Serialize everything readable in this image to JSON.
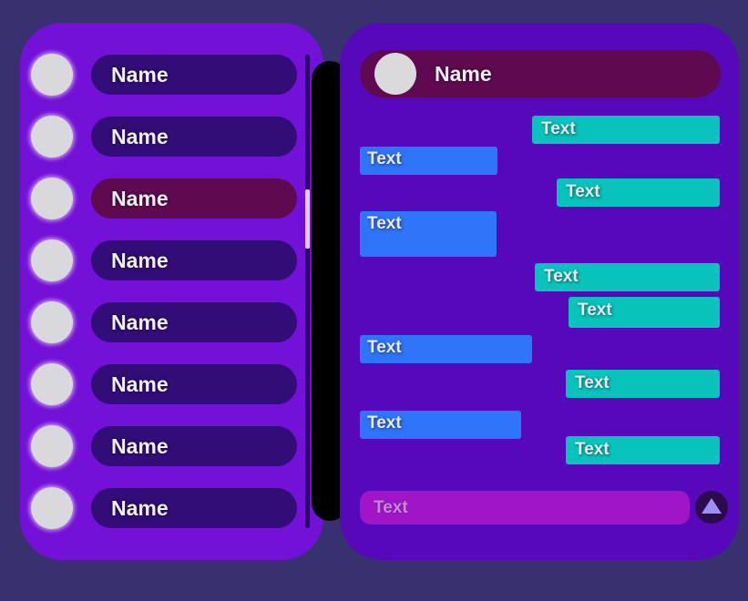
{
  "contacts": [
    {
      "name": "Name",
      "active": false
    },
    {
      "name": "Name",
      "active": false
    },
    {
      "name": "Name",
      "active": true
    },
    {
      "name": "Name",
      "active": false
    },
    {
      "name": "Name",
      "active": false
    },
    {
      "name": "Name",
      "active": false
    },
    {
      "name": "Name",
      "active": false
    },
    {
      "name": "Name",
      "active": false
    }
  ],
  "chat": {
    "header_name": "Name",
    "messages": [
      {
        "text": "Text",
        "direction": "out"
      },
      {
        "text": "Text",
        "direction": "in"
      },
      {
        "text": "Text",
        "direction": "out"
      },
      {
        "text": "Text",
        "direction": "in"
      },
      {
        "text": "Text",
        "direction": "out"
      },
      {
        "text": "Text",
        "direction": "out"
      },
      {
        "text": "Text",
        "direction": "in"
      },
      {
        "text": "Text",
        "direction": "out"
      },
      {
        "text": "Text",
        "direction": "in"
      },
      {
        "text": "Text",
        "direction": "out"
      }
    ],
    "input_placeholder": "Text"
  },
  "icons": {
    "send": "triangle-up-icon"
  },
  "colors": {
    "background": "#39306f",
    "contact_panel": "#7411d8",
    "chat_panel": "#5708bb",
    "active_contact": "#5e0950",
    "incoming_bubble": "#2f75fb",
    "outgoing_bubble": "#07c3bc",
    "input_field": "#a115c8",
    "send_icon": "#9b8ff6"
  }
}
